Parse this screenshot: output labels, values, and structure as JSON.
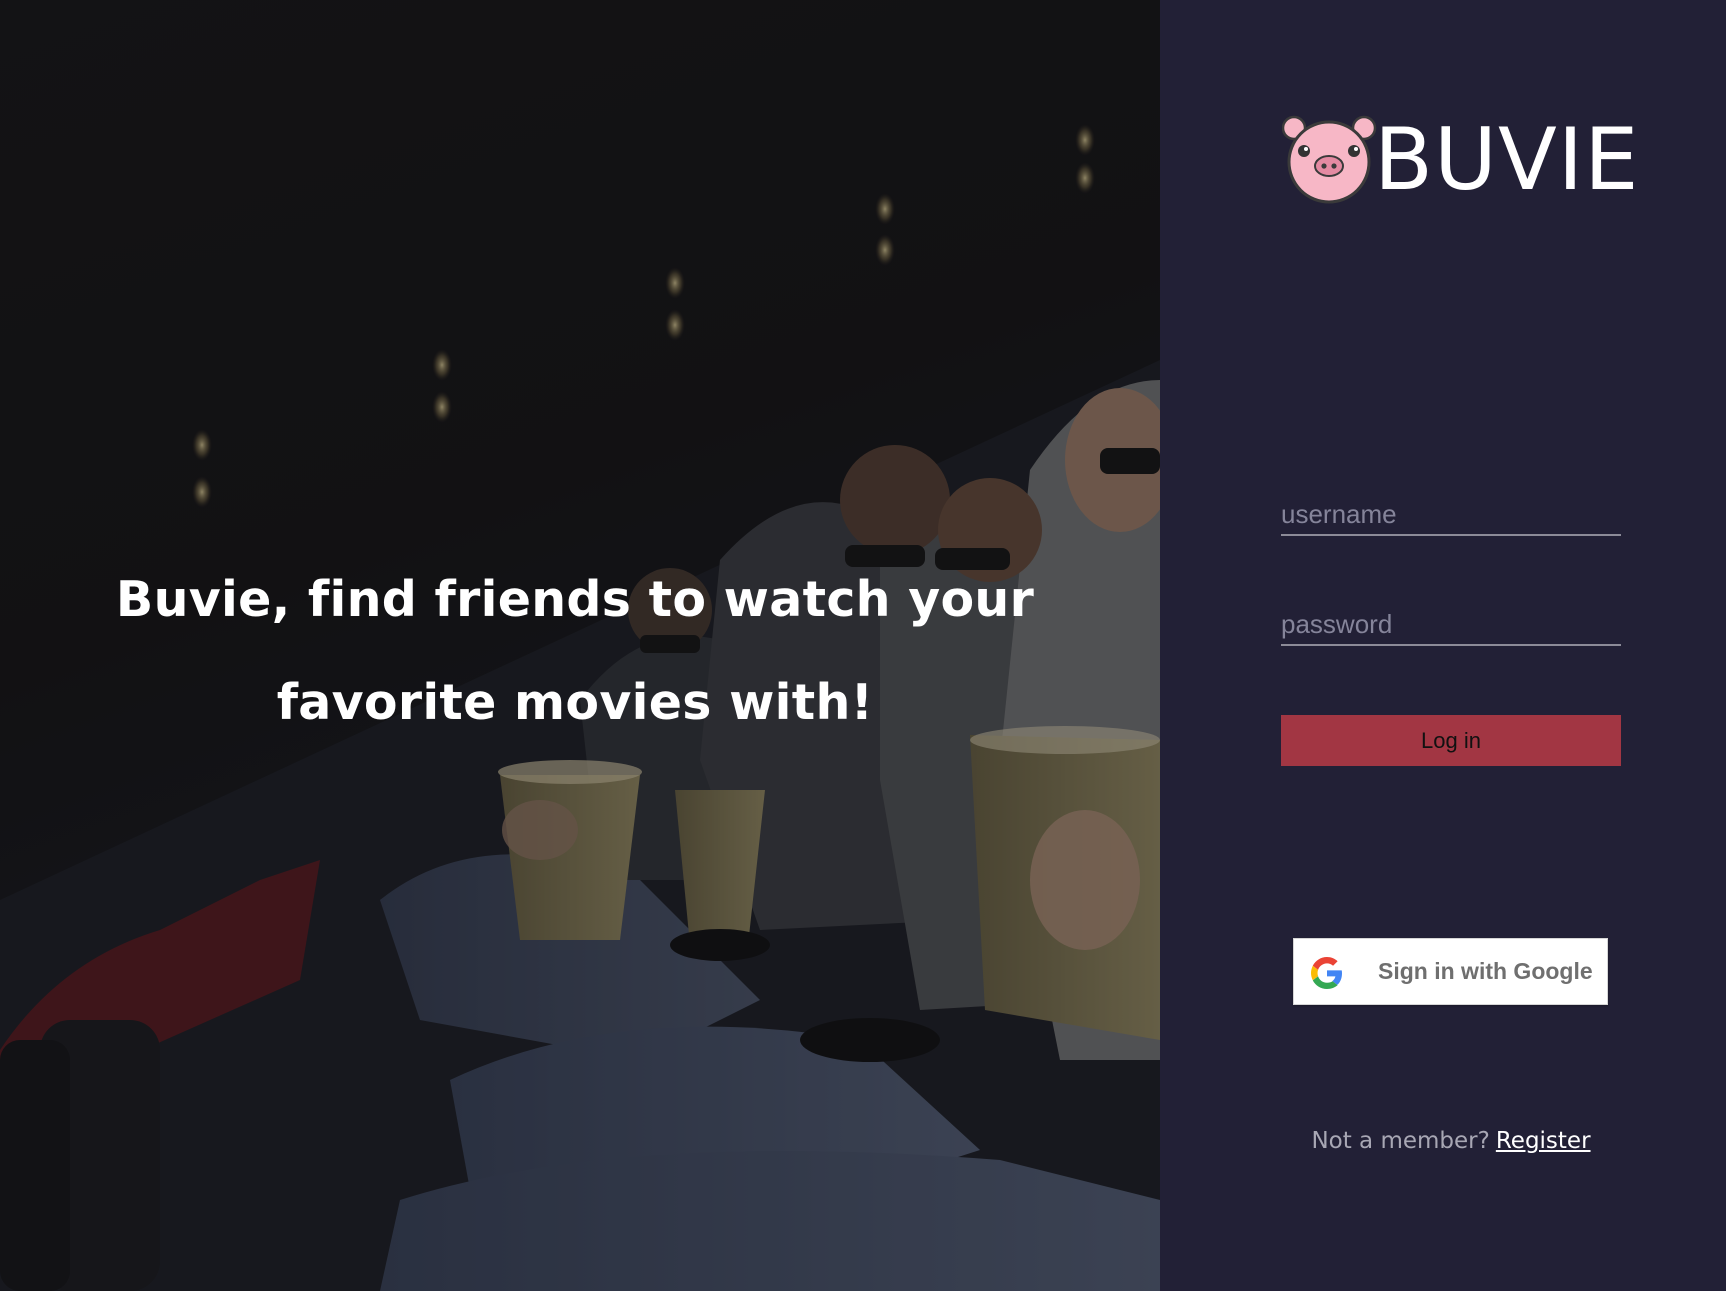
{
  "hero": {
    "tagline_line1": "Buvie, find friends to watch your",
    "tagline_line2": "favorite movies with!"
  },
  "brand": {
    "name": "BUVIE",
    "logo_icon": "pig-face-icon"
  },
  "login_form": {
    "username_placeholder": "username",
    "password_placeholder": "password",
    "login_label": "Log in",
    "login_color": "#a23643"
  },
  "google_signin": {
    "icon": "google-g-icon",
    "label": "Sign in with Google"
  },
  "register": {
    "prompt": "Not a member?",
    "link_label": "Register"
  },
  "colors": {
    "panel_bg": "#222036",
    "accent": "#a23643",
    "pig_pink": "#f7b7c6"
  }
}
